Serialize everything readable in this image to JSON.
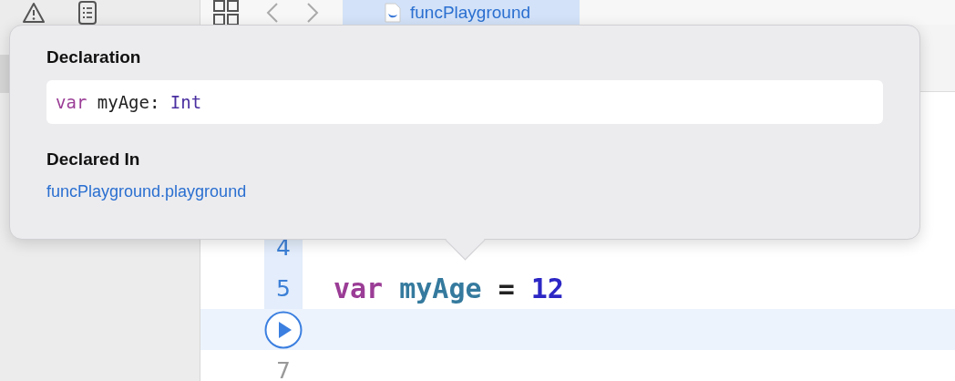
{
  "tabs": [
    {
      "label": "funcPlayground",
      "selected": true
    }
  ],
  "popover": {
    "declaration_heading": "Declaration",
    "declaration": [
      {
        "kind": "keyword",
        "text": "var"
      },
      {
        "kind": "plain",
        "text": " myAge: "
      },
      {
        "kind": "type",
        "text": "Int"
      }
    ],
    "declared_in_heading": "Declared In",
    "declared_in": "funcPlayground.playground"
  },
  "editor": {
    "lines": [
      {
        "kind": "number",
        "number": "4",
        "highlighted": true,
        "current": false
      },
      {
        "kind": "number",
        "number": "5",
        "highlighted": true,
        "current": false,
        "tokens": [
          {
            "kind": "keyword",
            "text": "var "
          },
          {
            "kind": "identifier",
            "text": "myAge "
          },
          {
            "kind": "operator",
            "text": "= "
          },
          {
            "kind": "number",
            "text": "12"
          }
        ]
      },
      {
        "kind": "run",
        "highlighted": false,
        "current": true
      },
      {
        "kind": "number",
        "number": "7",
        "highlighted": false,
        "current": false
      }
    ]
  }
}
